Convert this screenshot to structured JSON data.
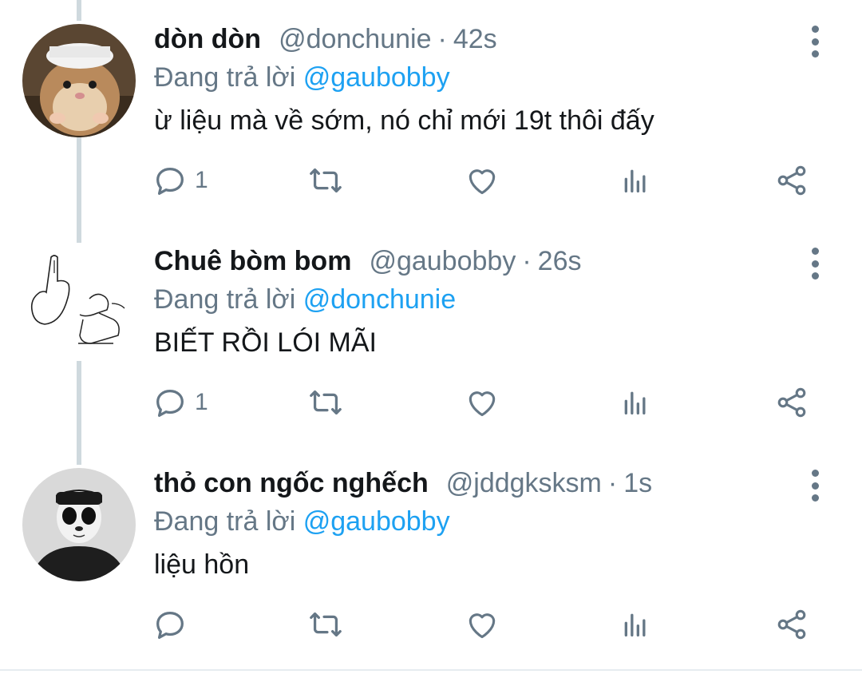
{
  "tweets": [
    {
      "name": "dòn dòn",
      "handle": "@donchunie",
      "sep": "·",
      "time": "42s",
      "replying_prefix": "Đang trả lời ",
      "replying_to": "@gaubobby",
      "text": "ừ liệu mà về sớm, nó chỉ mới 19t thôi đấy",
      "reply_count": "1",
      "avatar_icon": "hamster-avatar-icon"
    },
    {
      "name": "Chuê bòm bom",
      "handle": "@gaubobby",
      "sep": "·",
      "time": "26s",
      "replying_prefix": "Đang trả lời ",
      "replying_to": "@donchunie",
      "text": "BIẾT RỒI LÓI MÃI",
      "reply_count": "1",
      "avatar_icon": "sketch-avatar-icon"
    },
    {
      "name": "thỏ con ngốc nghếch",
      "handle": "@jddgksksm",
      "sep": "·",
      "time": "1s",
      "replying_prefix": "Đang trả lời ",
      "replying_to": "@gaubobby",
      "text": "liệu hồn",
      "reply_count": "",
      "avatar_icon": "panda-face-avatar-icon"
    }
  ],
  "icons": {
    "reply": "reply-icon",
    "retweet": "retweet-icon",
    "like": "heart-icon",
    "analytics": "analytics-icon",
    "share": "share-icon",
    "more": "more-vertical-icon"
  },
  "colors": {
    "name": "#14171a",
    "secondary": "#657786",
    "mention": "#1da1f2",
    "thread_line": "#cfd9de"
  }
}
